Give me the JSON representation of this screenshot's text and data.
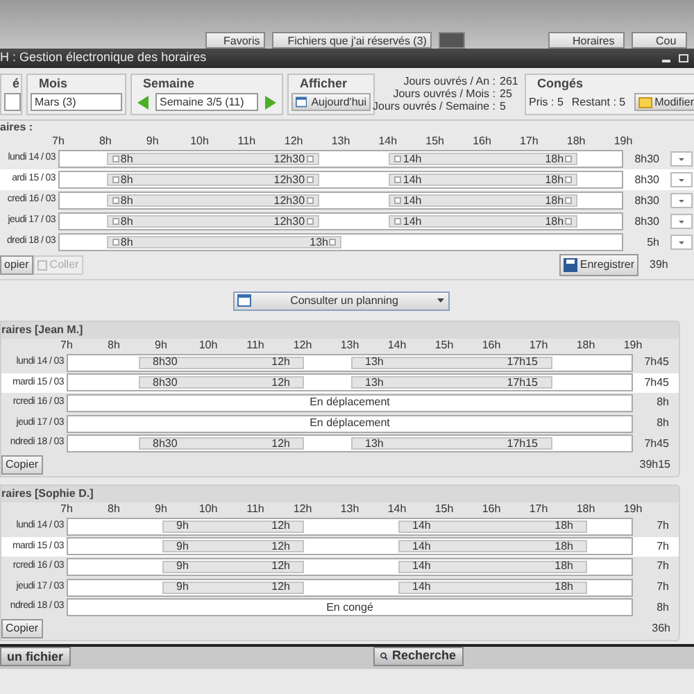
{
  "top_bar": {
    "buttons": [
      {
        "label": "Favoris"
      },
      {
        "label": "Fichiers que j'ai réservés (3)"
      },
      {
        "label": "Horaires"
      },
      {
        "label": "Cou"
      }
    ]
  },
  "window": {
    "title": "H : Gestion électronique des horaires"
  },
  "toolbar": {
    "group_1": {
      "header": "é"
    },
    "month": {
      "header": "Mois",
      "value": "Mars (3)"
    },
    "week": {
      "header": "Semaine",
      "value": "Semaine 3/5 (11)"
    },
    "display": {
      "header": "Afficher",
      "button": "Aujourd'hui"
    },
    "stats": [
      {
        "label": "Jours ouvrés / An :",
        "value": "261"
      },
      {
        "label": "Jours ouvrés / Mois :",
        "value": "25"
      },
      {
        "label": "Jours ouvrés / Semaine :",
        "value": "5"
      }
    ],
    "leave": {
      "header": "Congés",
      "taken": "Pris : 5",
      "remaining": "Restant : 5",
      "button": "Modifier"
    }
  },
  "my_schedule": {
    "title": "aires :",
    "editable": true,
    "hours": [
      "7h",
      "8h",
      "9h",
      "10h",
      "11h",
      "12h",
      "13h",
      "14h",
      "15h",
      "16h",
      "17h",
      "18h",
      "19h"
    ],
    "rows": [
      {
        "day": "lundi 14 / 03",
        "segments": [
          {
            "start": "8h",
            "end": "12h30"
          },
          {
            "start": "14h",
            "end": "18h"
          }
        ],
        "total": "8h30",
        "selected": false
      },
      {
        "day": "ardi 15 / 03",
        "segments": [
          {
            "start": "8h",
            "end": "12h30"
          },
          {
            "start": "14h",
            "end": "18h"
          }
        ],
        "total": "8h30",
        "selected": true
      },
      {
        "day": "credi 16 / 03",
        "segments": [
          {
            "start": "8h",
            "end": "12h30"
          },
          {
            "start": "14h",
            "end": "18h"
          }
        ],
        "total": "8h30",
        "selected": false
      },
      {
        "day": "jeudi 17 / 03",
        "segments": [
          {
            "start": "8h",
            "end": "12h30"
          },
          {
            "start": "14h",
            "end": "18h"
          }
        ],
        "total": "8h30",
        "selected": false
      },
      {
        "day": "dredi 18 / 03",
        "segments": [
          {
            "start": "8h",
            "end": "13h"
          }
        ],
        "total": "5h",
        "selected": false
      }
    ],
    "copy": "opier",
    "paste": "Coller",
    "save": "Enregistrer",
    "total": "39h"
  },
  "planning_dropdown": {
    "value": "Consulter un planning"
  },
  "panels": [
    {
      "title": "raires [Jean M.]",
      "editable": false,
      "hours": [
        "7h",
        "8h",
        "9h",
        "10h",
        "11h",
        "12h",
        "13h",
        "14h",
        "15h",
        "16h",
        "17h",
        "18h",
        "19h"
      ],
      "rows": [
        {
          "day": "lundi 14 / 03",
          "segments": [
            {
              "start": "8h30",
              "end": "12h"
            },
            {
              "start": "13h",
              "end": "17h15"
            }
          ],
          "total": "7h45",
          "selected": false
        },
        {
          "day": "mardi 15 / 03",
          "segments": [
            {
              "start": "8h30",
              "end": "12h"
            },
            {
              "start": "13h",
              "end": "17h15"
            }
          ],
          "total": "7h45",
          "selected": true
        },
        {
          "day": "rcredi 16 / 03",
          "note": "En déplacement",
          "total": "8h",
          "selected": false
        },
        {
          "day": "jeudi 17 / 03",
          "note": "En déplacement",
          "total": "8h",
          "selected": false
        },
        {
          "day": "ndredi 18 / 03",
          "segments": [
            {
              "start": "8h30",
              "end": "12h"
            },
            {
              "start": "13h",
              "end": "17h15"
            }
          ],
          "total": "7h45",
          "selected": false
        }
      ],
      "copy": "Copier",
      "total": "39h15"
    },
    {
      "title": "raires [Sophie D.]",
      "editable": false,
      "hours": [
        "7h",
        "8h",
        "9h",
        "10h",
        "11h",
        "12h",
        "13h",
        "14h",
        "15h",
        "16h",
        "17h",
        "18h",
        "19h"
      ],
      "rows": [
        {
          "day": "lundi 14 / 03",
          "segments": [
            {
              "start": "9h",
              "end": "12h"
            },
            {
              "start": "14h",
              "end": "18h"
            }
          ],
          "total": "7h",
          "selected": false
        },
        {
          "day": "mardi 15 / 03",
          "segments": [
            {
              "start": "9h",
              "end": "12h"
            },
            {
              "start": "14h",
              "end": "18h"
            }
          ],
          "total": "7h",
          "selected": true
        },
        {
          "day": "rcredi 16 / 03",
          "segments": [
            {
              "start": "9h",
              "end": "12h"
            },
            {
              "start": "14h",
              "end": "18h"
            }
          ],
          "total": "7h",
          "selected": false
        },
        {
          "day": "jeudi 17 / 03",
          "segments": [
            {
              "start": "9h",
              "end": "12h"
            },
            {
              "start": "14h",
              "end": "18h"
            }
          ],
          "total": "7h",
          "selected": false
        },
        {
          "day": "ndredi 18 / 03",
          "note": "En congé",
          "total": "8h",
          "selected": false
        }
      ],
      "copy": "Copier",
      "total": "36h"
    }
  ],
  "bottom_bar": {
    "buttons": [
      {
        "label": "un fichier"
      },
      {
        "label": "Recherche"
      }
    ]
  }
}
